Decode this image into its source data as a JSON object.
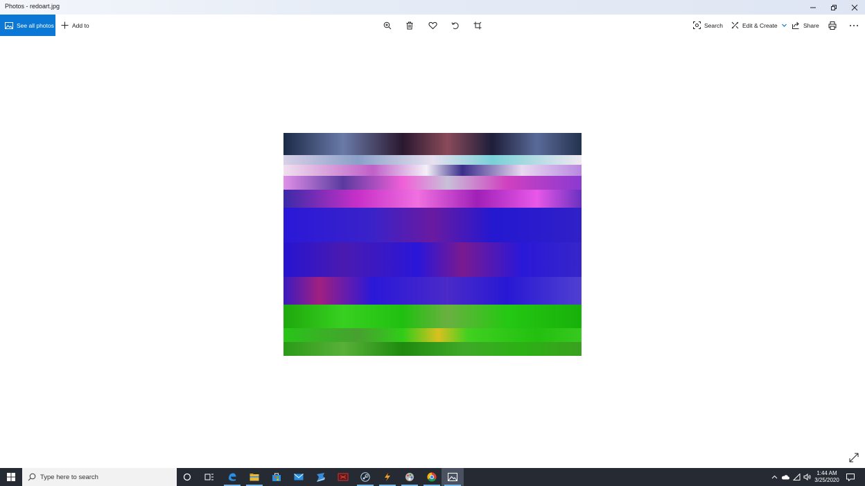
{
  "window": {
    "title": "Photos - redoart.jpg",
    "controls": [
      "minimize-icon",
      "restore-icon",
      "close-icon"
    ]
  },
  "toolbar": {
    "see_all_photos": "See all photos",
    "add_to": "Add to",
    "search": "Search",
    "edit_create": "Edit & Create",
    "share": "Share",
    "center_icons": [
      "zoom-icon",
      "delete-icon",
      "favorite-heart-icon",
      "rotate-icon",
      "crop-icon"
    ],
    "right_icons": [
      "print-icon",
      "more-ellipsis-icon"
    ]
  },
  "viewer": {
    "image_name": "redoart.jpg",
    "expand_icon": "expand-icon"
  },
  "taskbar": {
    "search_placeholder": "Type here to search",
    "apps": [
      "cortana-icon",
      "task-view-icon",
      "edge-icon",
      "file-explorer-icon",
      "store-icon",
      "mail-icon",
      "app-icon",
      "app-icon",
      "steam-icon",
      "app-icon",
      "app-icon",
      "chrome-icon",
      "photos-icon"
    ],
    "tray_icons": [
      "chevron-up-icon",
      "onedrive-cloud-icon",
      "wifi-icon",
      "volume-icon",
      "notification-icon"
    ],
    "time": "1:44 AM",
    "date": "3/25/2020"
  },
  "colors": {
    "accent": "#0a78d4",
    "taskbar": "#252a33",
    "photo_blue": "#2a18d8",
    "photo_green": "#22c90e",
    "photo_magenta": "#c828d0"
  }
}
